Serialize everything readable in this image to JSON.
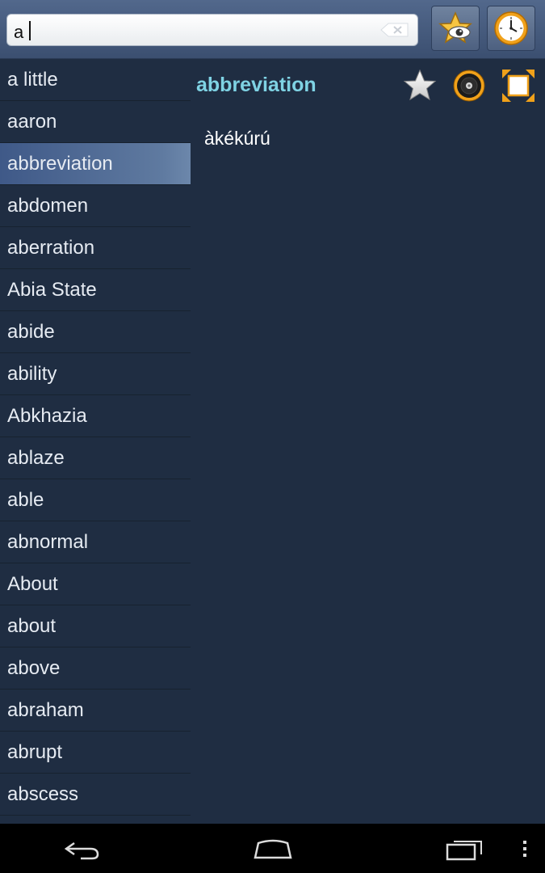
{
  "search": {
    "value": "a"
  },
  "words": [
    "a little",
    "aaron",
    "abbreviation",
    "abdomen",
    "aberration",
    "Abia State",
    "abide",
    "ability",
    "Abkhazia",
    "ablaze",
    "able",
    "abnormal",
    "About",
    "about",
    "above",
    "abraham",
    "abrupt",
    "abscess"
  ],
  "selected_index": 2,
  "detail": {
    "title": "abbreviation",
    "translation": "àkékúrú"
  },
  "colors": {
    "accent": "#7fd3e4",
    "background": "#1f2d42",
    "selected_row": "#5f7aa0",
    "star_gold": "#f7b320"
  },
  "icons": {
    "favorites_button": "star-eye-icon",
    "history_button": "clock-icon",
    "favorite": "star-icon",
    "sound": "speaker-icon",
    "expand": "fullscreen-icon",
    "back": "back-icon",
    "home": "home-icon",
    "recents": "recent-apps-icon",
    "menu": "overflow-menu-icon"
  }
}
